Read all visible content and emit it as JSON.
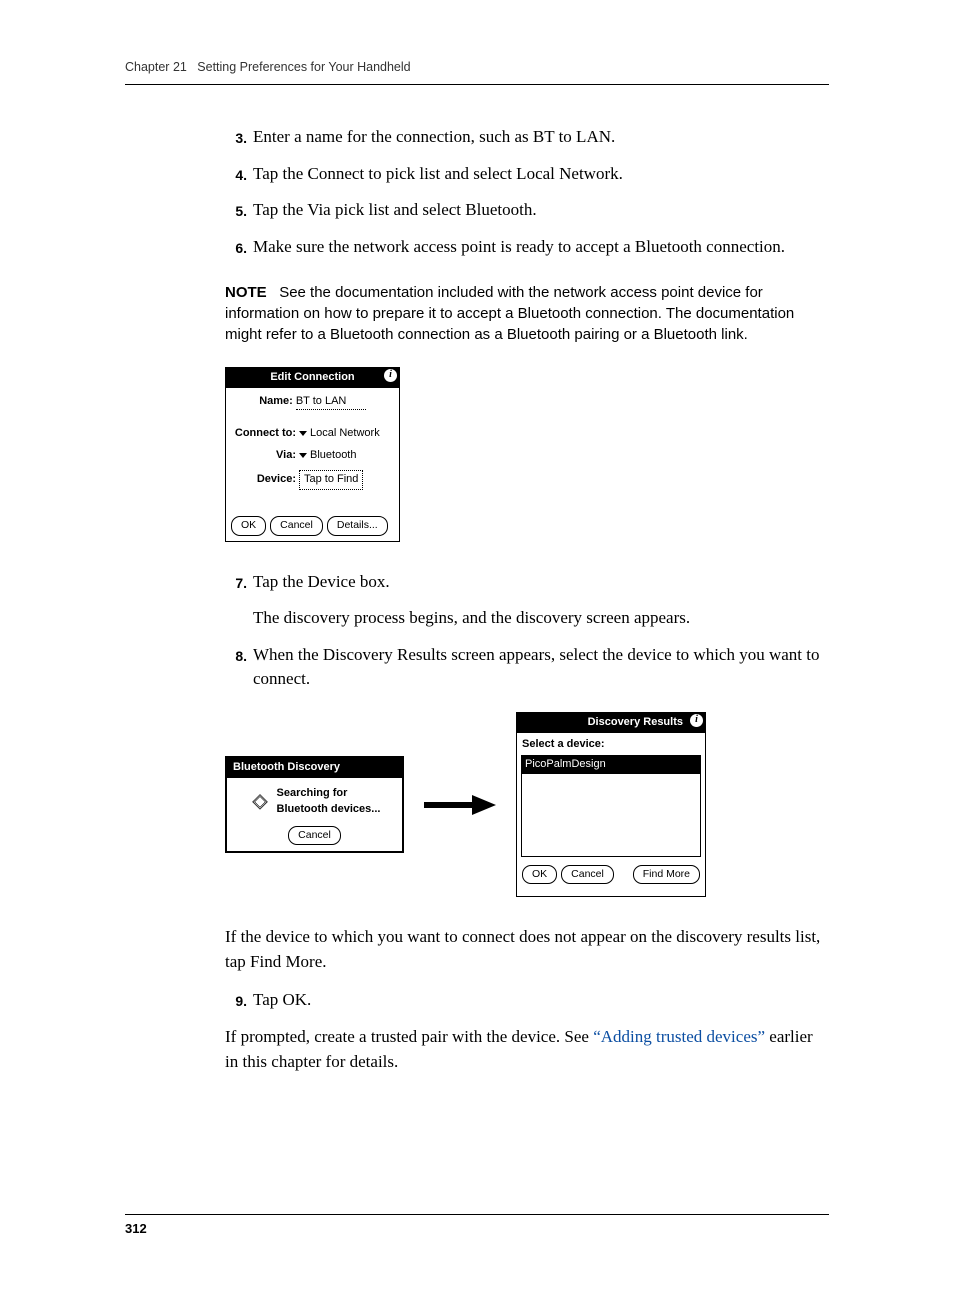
{
  "header": {
    "chapter": "Chapter 21",
    "title": "Setting Preferences for Your Handheld"
  },
  "steps": {
    "s3": {
      "num": "3.",
      "text": "Enter a name for the connection, such as BT to LAN."
    },
    "s4": {
      "num": "4.",
      "text": "Tap the Connect to pick list and select Local Network."
    },
    "s5": {
      "num": "5.",
      "text": "Tap the Via pick list and select Bluetooth."
    },
    "s6": {
      "num": "6.",
      "text": "Make sure the network access point is ready to accept a Bluetooth connection."
    },
    "s7": {
      "num": "7.",
      "text": "Tap the Device box.",
      "after": "The discovery process begins, and the discovery screen appears."
    },
    "s8": {
      "num": "8.",
      "text": "When the Discovery Results screen appears, select the device to which you want to connect.",
      "after": "If the device to which you want to connect does not appear on the discovery results list, tap Find More."
    },
    "s9": {
      "num": "9.",
      "text": "Tap OK."
    }
  },
  "note": {
    "label": "NOTE",
    "text": "See the documentation included with the network access point device for information on how to prepare it to accept a Bluetooth connection. The documentation might refer to a Bluetooth connection as a Bluetooth pairing or a Bluetooth link."
  },
  "closing": {
    "before": "If prompted, create a trusted pair with the device. See ",
    "link": "“Adding trusted devices”",
    "after": " earlier in this chapter for details."
  },
  "edit_screen": {
    "title": "Edit Connection",
    "name_label": "Name:",
    "name_value": "BT to LAN",
    "connect_label": "Connect to:",
    "connect_value": "Local Network",
    "via_label": "Via:",
    "via_value": "Bluetooth",
    "device_label": "Device:",
    "device_value": "Tap to Find",
    "ok": "OK",
    "cancel": "Cancel",
    "details": "Details..."
  },
  "discovery_dialog": {
    "title": "Bluetooth Discovery",
    "line1": "Searching for",
    "line2": "Bluetooth devices...",
    "cancel": "Cancel"
  },
  "results_screen": {
    "title": "Discovery Results",
    "prompt": "Select a device:",
    "device": "PicoPalmDesign",
    "ok": "OK",
    "cancel": "Cancel",
    "findmore": "Find More"
  },
  "footer": {
    "page": "312"
  }
}
